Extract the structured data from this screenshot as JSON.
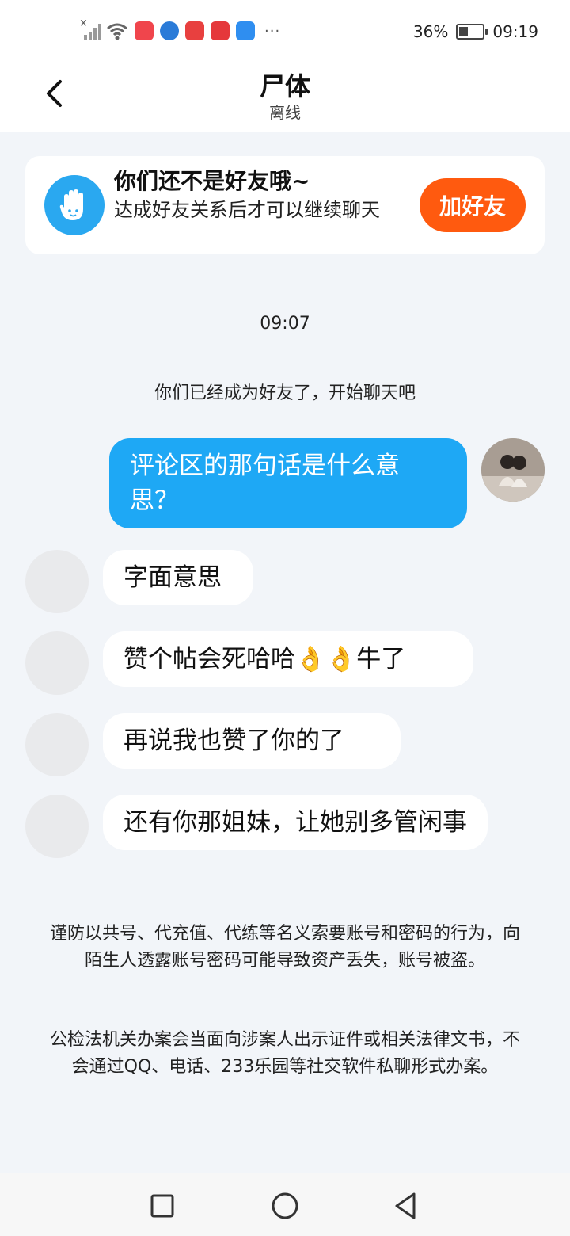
{
  "status_bar": {
    "battery_percent": "36%",
    "time": "09:19",
    "app_icons": [
      "xiaohongshu-icon",
      "browser-icon",
      "reader-icon",
      "huawei-store-icon",
      "weather-icon"
    ],
    "more": "···"
  },
  "header": {
    "title": "尸体",
    "status": "离线"
  },
  "friend_card": {
    "title": "你们还不是好友哦~",
    "description": "达成好友关系后才可以继续聊天",
    "button_label": "加好友"
  },
  "chat": {
    "timestamp": "09:07",
    "system_message": "你们已经成为好友了，开始聊天吧",
    "messages": [
      {
        "from": "me",
        "text": "评论区的那句话是什么意思？"
      },
      {
        "from": "other",
        "text": "字面意思"
      },
      {
        "from": "other",
        "text": "赞个帖会死哈哈👌👌牛了"
      },
      {
        "from": "other",
        "text": "再说我也赞了你的了"
      },
      {
        "from": "other",
        "text": "还有你那姐妹，让她别多管闲事"
      }
    ]
  },
  "notices": [
    "谨防以共号、代充值、代练等名义索要账号和密码的行为，向陌生人透露账号密码可能导致资产丢失，账号被盗。",
    "公检法机关办案会当面向涉案人出示证件或相关法律文书，不会通过QQ、电话、233乐园等社交软件私聊形式办案。"
  ],
  "colors": {
    "accent_blue": "#1ea8f5",
    "add_friend_orange": "#ff5a0f",
    "background": "#f2f5f9"
  }
}
